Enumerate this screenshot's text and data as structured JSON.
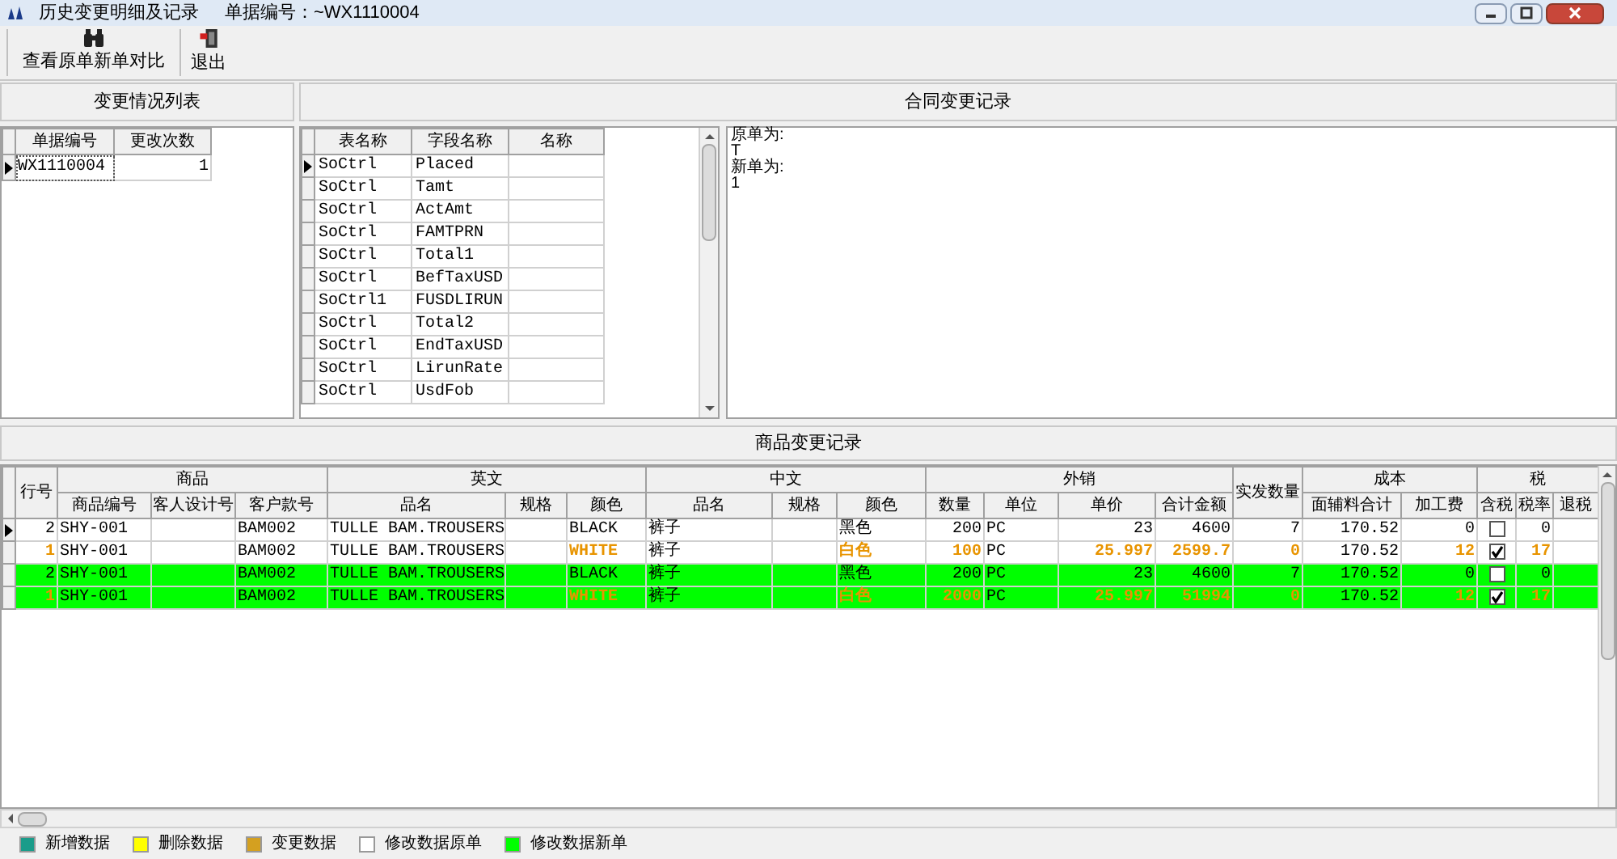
{
  "window": {
    "title": "历史变更明细及记录",
    "document_number": "单据编号：~WX1110004"
  },
  "toolbar": [
    {
      "kind": "compare",
      "label": "查看原单新单对比"
    },
    {
      "kind": "exit",
      "label": "退出"
    }
  ],
  "change_list": {
    "title": "变更情况列表",
    "columns": [
      "单据编号",
      "更改次数"
    ],
    "rows": [
      {
        "selected": true,
        "cells": [
          "WX1110004",
          "1"
        ]
      }
    ]
  },
  "contract_changes": {
    "title": "合同变更记录",
    "columns": [
      "表名称",
      "字段名称",
      "名称"
    ],
    "rows": [
      {
        "selected": true,
        "cells": [
          "SoCtrl",
          "Placed"
        ]
      },
      {
        "selected": false,
        "cells": [
          "SoCtrl",
          "Tamt"
        ]
      },
      {
        "selected": false,
        "cells": [
          "SoCtrl",
          "ActAmt"
        ]
      },
      {
        "selected": false,
        "cells": [
          "SoCtrl",
          "FAMTPRN"
        ]
      },
      {
        "selected": false,
        "cells": [
          "SoCtrl",
          "Total1"
        ]
      },
      {
        "selected": false,
        "cells": [
          "SoCtrl",
          "BefTaxUSD"
        ]
      },
      {
        "selected": false,
        "cells": [
          "SoCtrl1",
          "FUSDLIRUN"
        ]
      },
      {
        "selected": false,
        "cells": [
          "SoCtrl",
          "Total2"
        ]
      },
      {
        "selected": false,
        "cells": [
          "SoCtrl",
          "EndTaxUSD"
        ]
      },
      {
        "selected": false,
        "cells": [
          "SoCtrl",
          "LirunRate"
        ]
      },
      {
        "selected": false,
        "cells": [
          "SoCtrl",
          "UsdFob"
        ]
      }
    ],
    "detail_lines": [
      "原单为:",
      "T",
      "新单为:",
      "1"
    ]
  },
  "product_changes": {
    "title": "商品变更记录",
    "header": [
      {
        "label": "行号"
      },
      {
        "label": "商品",
        "columns": [
          "商品编号",
          "客人设计号",
          "客户款号"
        ]
      },
      {
        "label": "英文",
        "columns": [
          "品名",
          "规格",
          "颜色"
        ]
      },
      {
        "label": "中文",
        "columns": [
          "品名",
          "规格",
          "颜色"
        ]
      },
      {
        "label": "外销",
        "columns": [
          "数量",
          "单位",
          "单价",
          "合计金额"
        ]
      },
      {
        "label": "实发数量"
      },
      {
        "label": "成本",
        "columns": [
          "面辅料合计",
          "加工费"
        ]
      },
      {
        "label": "税",
        "columns": [
          "含税",
          "税率",
          "退税"
        ]
      }
    ],
    "rows": [
      {
        "selected": true,
        "kind": "original",
        "cells": [
          {
            "kind": "text",
            "text": "2",
            "changed": false
          },
          {
            "kind": "text",
            "text": "SHY-001",
            "changed": false
          },
          {
            "kind": "blank"
          },
          {
            "kind": "text",
            "text": "BAM002",
            "changed": false
          },
          {
            "kind": "text",
            "text": "TULLE BAM.TROUSERS",
            "changed": false
          },
          {
            "kind": "blank"
          },
          {
            "kind": "text",
            "text": "BLACK",
            "changed": false
          },
          {
            "kind": "text",
            "text": "裤子",
            "changed": false
          },
          {
            "kind": "blank"
          },
          {
            "kind": "text",
            "text": "黑色",
            "changed": false
          },
          {
            "kind": "text",
            "text": "200",
            "changed": false
          },
          {
            "kind": "text",
            "text": "PC",
            "changed": false
          },
          {
            "kind": "text",
            "text": "23",
            "changed": false
          },
          {
            "kind": "text",
            "text": "4600",
            "changed": false
          },
          {
            "kind": "text",
            "text": "7",
            "changed": false
          },
          {
            "kind": "text",
            "text": "170.52",
            "changed": false
          },
          {
            "kind": "text",
            "text": "0",
            "changed": false
          },
          {
            "kind": "checkbox",
            "checked": false
          },
          {
            "kind": "text",
            "text": "0",
            "changed": false
          },
          {
            "kind": "blank"
          }
        ]
      },
      {
        "selected": false,
        "kind": "original",
        "cells": [
          {
            "kind": "text",
            "text": "1",
            "changed": true
          },
          {
            "kind": "text",
            "text": "SHY-001",
            "changed": false
          },
          {
            "kind": "blank"
          },
          {
            "kind": "text",
            "text": "BAM002",
            "changed": false
          },
          {
            "kind": "text",
            "text": "TULLE BAM.TROUSERS",
            "changed": false
          },
          {
            "kind": "blank"
          },
          {
            "kind": "text",
            "text": "WHITE",
            "changed": true
          },
          {
            "kind": "text",
            "text": "裤子",
            "changed": false
          },
          {
            "kind": "blank"
          },
          {
            "kind": "text",
            "text": "白色",
            "changed": true
          },
          {
            "kind": "text",
            "text": "100",
            "changed": true
          },
          {
            "kind": "text",
            "text": "PC",
            "changed": false
          },
          {
            "kind": "text",
            "text": "25.997",
            "changed": true
          },
          {
            "kind": "text",
            "text": "2599.7",
            "changed": true
          },
          {
            "kind": "text",
            "text": "0",
            "changed": true
          },
          {
            "kind": "text",
            "text": "170.52",
            "changed": false
          },
          {
            "kind": "text",
            "text": "12",
            "changed": true
          },
          {
            "kind": "checkbox",
            "checked": true
          },
          {
            "kind": "text",
            "text": "17",
            "changed": true
          },
          {
            "kind": "blank"
          }
        ]
      },
      {
        "selected": false,
        "kind": "new",
        "cells": [
          {
            "kind": "text",
            "text": "2",
            "changed": false
          },
          {
            "kind": "text",
            "text": "SHY-001",
            "changed": false
          },
          {
            "kind": "blank"
          },
          {
            "kind": "text",
            "text": "BAM002",
            "changed": false
          },
          {
            "kind": "text",
            "text": "TULLE BAM.TROUSERS",
            "changed": false
          },
          {
            "kind": "blank"
          },
          {
            "kind": "text",
            "text": "BLACK",
            "changed": false
          },
          {
            "kind": "text",
            "text": "裤子",
            "changed": false
          },
          {
            "kind": "blank"
          },
          {
            "kind": "text",
            "text": "黑色",
            "changed": false
          },
          {
            "kind": "text",
            "text": "200",
            "changed": false
          },
          {
            "kind": "text",
            "text": "PC",
            "changed": false
          },
          {
            "kind": "text",
            "text": "23",
            "changed": false
          },
          {
            "kind": "text",
            "text": "4600",
            "changed": false
          },
          {
            "kind": "text",
            "text": "7",
            "changed": false
          },
          {
            "kind": "text",
            "text": "170.52",
            "changed": false
          },
          {
            "kind": "text",
            "text": "0",
            "changed": false
          },
          {
            "kind": "checkbox",
            "checked": false
          },
          {
            "kind": "text",
            "text": "0",
            "changed": false
          },
          {
            "kind": "blank"
          }
        ]
      },
      {
        "selected": false,
        "kind": "new",
        "cells": [
          {
            "kind": "text",
            "text": "1",
            "changed": true
          },
          {
            "kind": "text",
            "text": "SHY-001",
            "changed": false
          },
          {
            "kind": "blank"
          },
          {
            "kind": "text",
            "text": "BAM002",
            "changed": false
          },
          {
            "kind": "text",
            "text": "TULLE BAM.TROUSERS",
            "changed": false
          },
          {
            "kind": "blank"
          },
          {
            "kind": "text",
            "text": "WHITE",
            "changed": true
          },
          {
            "kind": "text",
            "text": "裤子",
            "changed": false
          },
          {
            "kind": "blank"
          },
          {
            "kind": "text",
            "text": "白色",
            "changed": true
          },
          {
            "kind": "text",
            "text": "2000",
            "changed": true
          },
          {
            "kind": "text",
            "text": "PC",
            "changed": false
          },
          {
            "kind": "text",
            "text": "25.997",
            "changed": true
          },
          {
            "kind": "text",
            "text": "51994",
            "changed": true
          },
          {
            "kind": "text",
            "text": "0",
            "changed": true
          },
          {
            "kind": "text",
            "text": "170.52",
            "changed": false
          },
          {
            "kind": "text",
            "text": "12",
            "changed": true
          },
          {
            "kind": "checkbox",
            "checked": true
          },
          {
            "kind": "text",
            "text": "17",
            "changed": true
          },
          {
            "kind": "blank"
          }
        ]
      }
    ]
  },
  "legend": [
    {
      "label": "新增数据",
      "color": "#1a9c8a"
    },
    {
      "label": "删除数据",
      "color": "#ffff00"
    },
    {
      "label": "变更数据",
      "color": "#d4a020"
    },
    {
      "label": "修改数据原单",
      "color": "#ffffff"
    },
    {
      "label": "修改数据新单",
      "color": "#00ff00"
    }
  ]
}
